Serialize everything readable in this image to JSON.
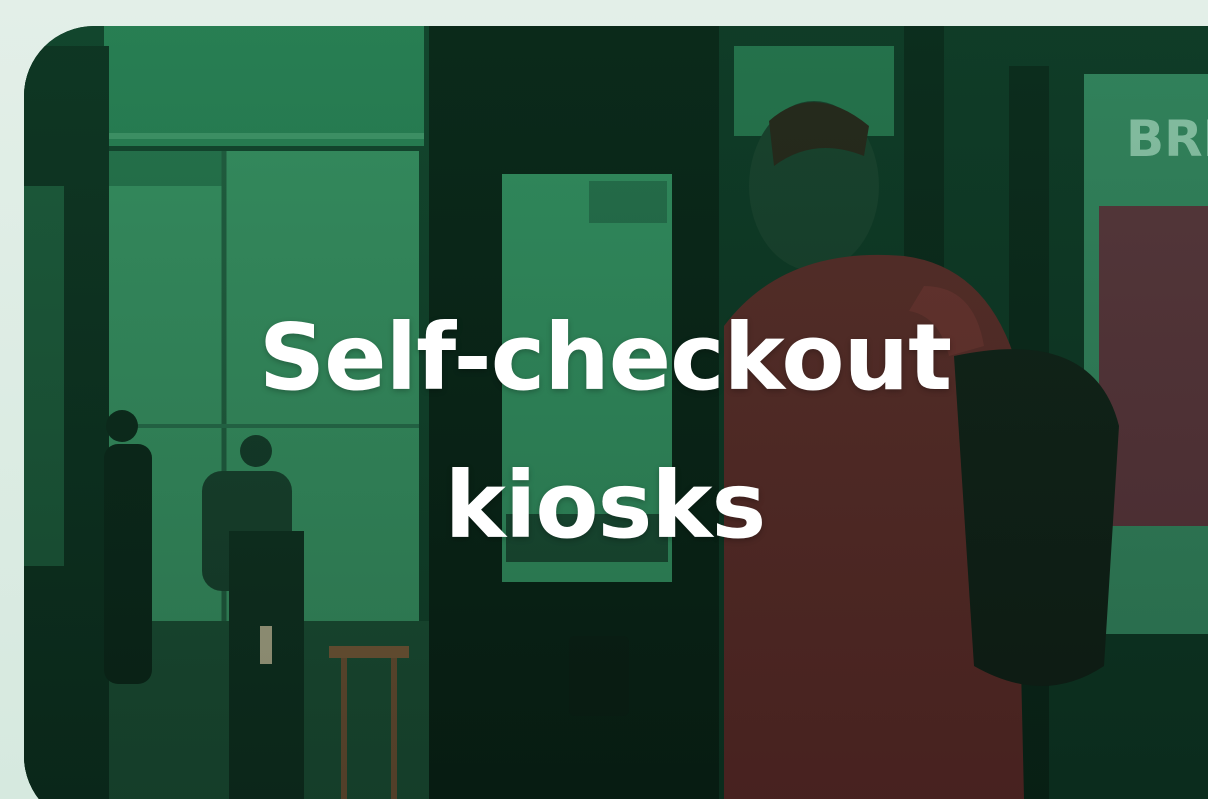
{
  "hero": {
    "title_line1": "Self-checkout",
    "title_line2": "kiosks",
    "poster_text": "BRE"
  },
  "colors": {
    "page_background": "#dcebe3",
    "card_tint": "#0f3a26",
    "headline": "#ffffff",
    "jacket": "#6a2326"
  }
}
